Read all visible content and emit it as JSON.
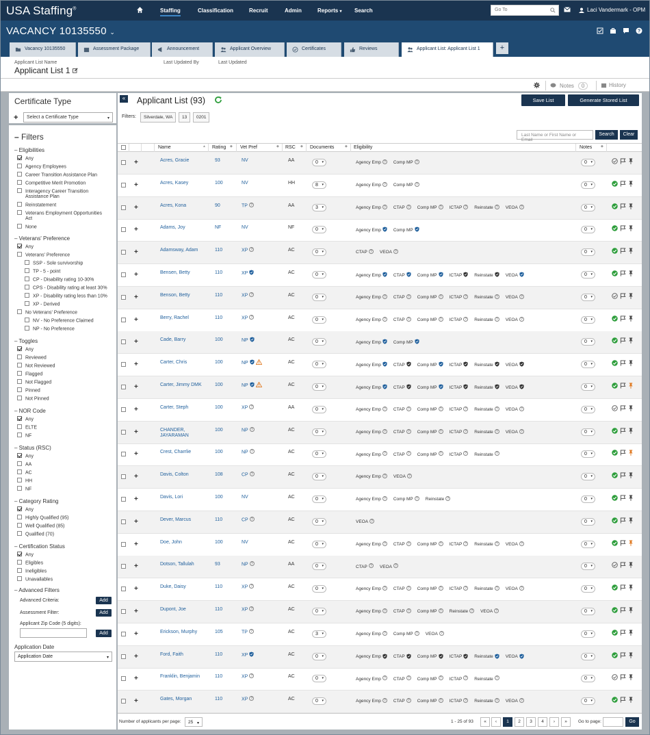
{
  "app": {
    "logo": "USA Staffing",
    "logo_mark": "®"
  },
  "nav": {
    "staffing": "Staffing",
    "classification": "Classification",
    "recruit": "Recruit",
    "admin": "Admin",
    "reports": "Reports",
    "search": "Search",
    "goto_placeholder": "Go To",
    "user": "Laci Vandermark - OPM"
  },
  "vacancy": {
    "title": "VACANCY 10135550"
  },
  "tabs": [
    {
      "label": "Vacancy 10135550",
      "icon": "folder-icon"
    },
    {
      "label": "Assessment Package",
      "icon": "package-icon"
    },
    {
      "label": "Announcement",
      "icon": "megaphone-icon"
    },
    {
      "label": "Applicant Overview",
      "icon": "users-icon"
    },
    {
      "label": "Certificates",
      "icon": "certificate-icon"
    },
    {
      "label": "Reviews",
      "icon": "thumbs-up-icon"
    },
    {
      "label": "Applicant List: Applicant List 1",
      "icon": "users-icon"
    }
  ],
  "tab_add": "+",
  "list_header": {
    "name_label": "Applicant List Name",
    "name": "Applicant List 1",
    "updated_by_label": "Last Updated By",
    "updated_label": "Last Updated",
    "notes_label": "Notes",
    "notes_count": "0",
    "history_label": "History"
  },
  "sidebar": {
    "cert_type_title": "Certificate Type",
    "cert_type_placeholder": "Select a Certificate Type",
    "filters_title": "Filters",
    "eligibilities": {
      "title": "Eligibilities",
      "options": [
        "Any",
        "Agency Employees",
        "Career Transition Assistance Plan",
        "Competitive Merit Promotion",
        "Interagency Career Transition Assistance Plan",
        "Reinstatement",
        "Veterans Employment Opportunities Act",
        "None"
      ]
    },
    "vets": {
      "title": "Veterans' Preference",
      "any": "Any",
      "vp": "Veterans' Preference",
      "vp_sub": [
        "SSP - Sole survivorship",
        "TP - 5 - point",
        "CP - Disability rating 10-30%",
        "CPS - Disability rating at least 30%",
        "XP - Disability rating less than 10%",
        "XP - Derived"
      ],
      "nvp": "No Veterans' Preference",
      "nvp_sub": [
        "NV - No Preference Claimed",
        "NP - No Preference"
      ]
    },
    "toggles": {
      "title": "Toggles",
      "options": [
        "Any",
        "Reviewed",
        "Not Reviewed",
        "Flagged",
        "Not Flagged",
        "Pinned",
        "Not Pinned"
      ]
    },
    "nor": {
      "title": "NOR Code",
      "options": [
        "Any",
        "ELTE",
        "NF"
      ]
    },
    "status": {
      "title": "Status (RSC)",
      "options": [
        "Any",
        "AA",
        "AC",
        "HH",
        "NF"
      ]
    },
    "category": {
      "title": "Category Rating",
      "options": [
        "Any",
        "Highly Qualified (95)",
        "Well Qualified (85)",
        "Qualified (70)"
      ]
    },
    "cert_status": {
      "title": "Certification Status",
      "options": [
        "Any",
        "Eligibles",
        "Ineligibles",
        "Unavailables"
      ]
    },
    "advanced": {
      "title": "Advanced Filters",
      "criteria": "Advanced Criteria:",
      "assessment": "Assessment Filter:",
      "zip": "Applicant Zip Code (5 digits):",
      "add": "Add"
    },
    "app_date_label": "Application Date",
    "app_date_value": "Application Date"
  },
  "main": {
    "title": "Applicant List (93)",
    "save_list": "Save List",
    "generate": "Generate Stored List",
    "filters_label": "Filters:",
    "filter_chips": [
      "Silverdale, WA",
      "13",
      "0201"
    ],
    "search_placeholder": "Last Name or First Name or Email",
    "search": "Search",
    "clear": "Clear"
  },
  "columns": [
    "Name",
    "Rating",
    "Vet Pref",
    "RSC",
    "Documents",
    "Eligibility",
    "Notes"
  ],
  "rows": [
    {
      "name": "Acres, Gracie",
      "rating": "93",
      "vet": "NV",
      "rsc": "AA",
      "docs": "0",
      "notes": "0",
      "elig": [
        [
          "Agency Emp",
          "q"
        ],
        [
          "Comp MP",
          "q"
        ]
      ],
      "reviewed": false,
      "pinned": false
    },
    {
      "name": "Acres, Kasey",
      "rating": "100",
      "vet": "NV",
      "rsc": "HH",
      "docs": "8",
      "notes": "0",
      "elig": [
        [
          "Agency Emp",
          "q"
        ],
        [
          "Comp MP",
          "q"
        ]
      ],
      "reviewed": true,
      "pinned": false
    },
    {
      "name": "Acres, Kona",
      "rating": "90",
      "vet": "TP",
      "veticon": "q",
      "rsc": "AA",
      "docs": "3",
      "notes": "0",
      "elig": [
        [
          "Agency Emp",
          "q"
        ],
        [
          "CTAP",
          "q"
        ],
        [
          "Comp MP",
          "q"
        ],
        [
          "ICTAP",
          "q"
        ],
        [
          "Reinstate",
          "q"
        ],
        [
          "VEOA",
          "q"
        ]
      ],
      "reviewed": true,
      "pinned": false
    },
    {
      "name": "Adams, Joy",
      "rating": "NF",
      "vet": "NV",
      "rsc": "NF",
      "docs": "0",
      "notes": "0",
      "elig": [
        [
          "Agency Emp",
          "blue"
        ],
        [
          "Comp MP",
          "blue"
        ]
      ],
      "reviewed": true,
      "pinned": false
    },
    {
      "name": "Adamsway, Adam",
      "rating": "110",
      "vet": "XP",
      "veticon": "q",
      "rsc": "AC",
      "docs": "0",
      "notes": "0",
      "elig": [
        [
          "CTAP",
          "q"
        ],
        [
          "VEOA",
          "q"
        ]
      ],
      "reviewed": true,
      "pinned": false
    },
    {
      "name": "Bensen, Betty",
      "rating": "110",
      "vet": "XP",
      "veticon": "blue",
      "rsc": "AC",
      "docs": "0",
      "notes": "0",
      "elig": [
        [
          "Agency Emp",
          "blue"
        ],
        [
          "CTAP",
          "blue"
        ],
        [
          "Comp MP",
          "blue"
        ],
        [
          "ICTAP",
          "dark"
        ],
        [
          "Reinstate",
          "dark"
        ],
        [
          "VEOA",
          "blue"
        ]
      ],
      "reviewed": true,
      "pinned": false
    },
    {
      "name": "Benson, Betty",
      "rating": "110",
      "vet": "XP",
      "veticon": "q",
      "rsc": "AC",
      "docs": "0",
      "notes": "0",
      "elig": [
        [
          "Agency Emp",
          "q"
        ],
        [
          "CTAP",
          "q"
        ],
        [
          "Comp MP",
          "q"
        ],
        [
          "ICTAP",
          "q"
        ],
        [
          "Reinstate",
          "q"
        ],
        [
          "VEOA",
          "q"
        ]
      ],
      "reviewed": false,
      "pinned": false
    },
    {
      "name": "Berry, Rachel",
      "rating": "110",
      "vet": "XP",
      "veticon": "q",
      "rsc": "AC",
      "docs": "0",
      "notes": "0",
      "elig": [
        [
          "Agency Emp",
          "q"
        ],
        [
          "CTAP",
          "q"
        ],
        [
          "Comp MP",
          "q"
        ],
        [
          "ICTAP",
          "q"
        ],
        [
          "Reinstate",
          "q"
        ],
        [
          "VEOA",
          "q"
        ]
      ],
      "reviewed": true,
      "pinned": false
    },
    {
      "name": "Cade, Barry",
      "rating": "100",
      "vet": "NP",
      "veticon": "blue",
      "rsc": "AC",
      "docs": "0",
      "notes": "0",
      "elig": [
        [
          "Agency Emp",
          "blue"
        ],
        [
          "Comp MP",
          "blue"
        ]
      ],
      "reviewed": true,
      "pinned": false
    },
    {
      "name": "Carter, Chris",
      "rating": "100",
      "vet": "NP",
      "veticon": "blue",
      "warn": true,
      "rsc": "AC",
      "docs": "0",
      "notes": "0",
      "elig": [
        [
          "Agency Emp",
          "blue"
        ],
        [
          "CTAP",
          "dark"
        ],
        [
          "Comp MP",
          "blue"
        ],
        [
          "ICTAP",
          "dark"
        ],
        [
          "Reinstate",
          "dark"
        ],
        [
          "VEOA",
          "dark"
        ]
      ],
      "reviewed": true,
      "pinned": false
    },
    {
      "name": "Carter, Jimmy DMK",
      "rating": "100",
      "vet": "NP",
      "veticon": "blue",
      "warn": true,
      "rsc": "AC",
      "docs": "0",
      "notes": "0",
      "elig": [
        [
          "Agency Emp",
          "blue"
        ],
        [
          "CTAP",
          "dark"
        ],
        [
          "Comp MP",
          "blue"
        ],
        [
          "ICTAP",
          "dark"
        ],
        [
          "Reinstate",
          "dark"
        ],
        [
          "VEOA",
          "dark"
        ]
      ],
      "reviewed": true,
      "pinned": true
    },
    {
      "name": "Carter, Steph",
      "rating": "100",
      "vet": "XP",
      "veticon": "q",
      "rsc": "AA",
      "docs": "0",
      "notes": "0",
      "elig": [
        [
          "Agency Emp",
          "q"
        ],
        [
          "CTAP",
          "q"
        ],
        [
          "Comp MP",
          "q"
        ],
        [
          "ICTAP",
          "q"
        ],
        [
          "Reinstate",
          "q"
        ],
        [
          "VEOA",
          "q"
        ]
      ],
      "reviewed": false,
      "pinned": false
    },
    {
      "name": "CHANDER, JAYARAMAN",
      "rating": "100",
      "vet": "NP",
      "veticon": "q",
      "rsc": "AC",
      "docs": "0",
      "notes": "0",
      "elig": [
        [
          "Agency Emp",
          "q"
        ],
        [
          "CTAP",
          "q"
        ],
        [
          "Comp MP",
          "q"
        ],
        [
          "ICTAP",
          "q"
        ],
        [
          "Reinstate",
          "q"
        ],
        [
          "VEOA",
          "q"
        ]
      ],
      "reviewed": true,
      "pinned": false
    },
    {
      "name": "Crest, Charrlie",
      "rating": "100",
      "vet": "NP",
      "veticon": "q",
      "rsc": "AC",
      "docs": "0",
      "notes": "0",
      "elig": [
        [
          "Agency Emp",
          "q"
        ],
        [
          "CTAP",
          "q"
        ],
        [
          "Comp MP",
          "q"
        ],
        [
          "ICTAP",
          "q"
        ],
        [
          "Reinstate",
          "q"
        ]
      ],
      "reviewed": true,
      "pinned": true
    },
    {
      "name": "Davis, Colton",
      "rating": "108",
      "vet": "CP",
      "veticon": "q",
      "rsc": "AC",
      "docs": "0",
      "notes": "0",
      "elig": [
        [
          "Agency Emp",
          "q"
        ],
        [
          "VEOA",
          "q"
        ]
      ],
      "reviewed": true,
      "pinned": false
    },
    {
      "name": "Davis, Lori",
      "rating": "100",
      "vet": "NV",
      "rsc": "AC",
      "docs": "0",
      "notes": "0",
      "elig": [
        [
          "Agency Emp",
          "q"
        ],
        [
          "Comp MP",
          "q"
        ],
        [
          "Reinstate",
          "q"
        ]
      ],
      "reviewed": true,
      "pinned": false
    },
    {
      "name": "Dever, Marcus",
      "rating": "110",
      "vet": "CP",
      "veticon": "q",
      "rsc": "AC",
      "docs": "0",
      "notes": "0",
      "elig": [
        [
          "VEOA",
          "q"
        ]
      ],
      "reviewed": true,
      "pinned": false
    },
    {
      "name": "Doe, John",
      "rating": "100",
      "vet": "NV",
      "rsc": "AC",
      "docs": "0",
      "notes": "0",
      "elig": [
        [
          "Agency Emp",
          "q"
        ],
        [
          "CTAP",
          "q"
        ],
        [
          "Comp MP",
          "q"
        ],
        [
          "ICTAP",
          "q"
        ],
        [
          "Reinstate",
          "q"
        ],
        [
          "VEOA",
          "q"
        ]
      ],
      "reviewed": true,
      "pinned": true
    },
    {
      "name": "Dotson, Tallulah",
      "rating": "93",
      "vet": "NP",
      "veticon": "q",
      "rsc": "AA",
      "docs": "0",
      "notes": "0",
      "elig": [
        [
          "CTAP",
          "q"
        ],
        [
          "VEOA",
          "q"
        ]
      ],
      "reviewed": false,
      "pinned": false
    },
    {
      "name": "Duke, Daisy",
      "rating": "110",
      "vet": "XP",
      "veticon": "q",
      "rsc": "AC",
      "docs": "0",
      "notes": "0",
      "elig": [
        [
          "Agency Emp",
          "q"
        ],
        [
          "CTAP",
          "q"
        ],
        [
          "Comp MP",
          "q"
        ],
        [
          "ICTAP",
          "q"
        ],
        [
          "Reinstate",
          "q"
        ],
        [
          "VEOA",
          "q"
        ]
      ],
      "reviewed": true,
      "pinned": false
    },
    {
      "name": "Dupont, Joe",
      "rating": "110",
      "vet": "XP",
      "veticon": "q",
      "rsc": "AC",
      "docs": "0",
      "notes": "0",
      "elig": [
        [
          "Agency Emp",
          "q"
        ],
        [
          "CTAP",
          "q"
        ],
        [
          "Comp MP",
          "q"
        ],
        [
          "Reinstate",
          "q"
        ],
        [
          "VEOA",
          "q"
        ]
      ],
      "reviewed": true,
      "pinned": false
    },
    {
      "name": "Erickson, Murphy",
      "rating": "105",
      "vet": "TP",
      "veticon": "q",
      "rsc": "AC",
      "docs": "3",
      "notes": "0",
      "elig": [
        [
          "Agency Emp",
          "q"
        ],
        [
          "Comp MP",
          "q"
        ],
        [
          "VEOA",
          "q"
        ]
      ],
      "reviewed": true,
      "pinned": false
    },
    {
      "name": "Ford, Faith",
      "rating": "110",
      "vet": "XP",
      "veticon": "blue",
      "rsc": "AC",
      "docs": "0",
      "notes": "0",
      "elig": [
        [
          "Agency Emp",
          "dark"
        ],
        [
          "CTAP",
          "dark"
        ],
        [
          "Comp MP",
          "dark"
        ],
        [
          "ICTAP",
          "dark"
        ],
        [
          "Reinstate",
          "blue"
        ],
        [
          "VEOA",
          "blue"
        ]
      ],
      "reviewed": true,
      "pinned": false
    },
    {
      "name": "Franklin, Benjamin",
      "rating": "110",
      "vet": "XP",
      "veticon": "q",
      "rsc": "AC",
      "docs": "0",
      "notes": "0",
      "elig": [
        [
          "Agency Emp",
          "q"
        ],
        [
          "CTAP",
          "q"
        ],
        [
          "Comp MP",
          "q"
        ],
        [
          "ICTAP",
          "q"
        ],
        [
          "Reinstate",
          "q"
        ]
      ],
      "reviewed": false,
      "pinned": false
    },
    {
      "name": "Gates, Morgan",
      "rating": "110",
      "vet": "XP",
      "veticon": "q",
      "rsc": "AC",
      "docs": "0",
      "notes": "0",
      "elig": [
        [
          "Agency Emp",
          "q"
        ],
        [
          "CTAP",
          "q"
        ],
        [
          "Comp MP",
          "q"
        ],
        [
          "ICTAP",
          "q"
        ],
        [
          "Reinstate",
          "q"
        ],
        [
          "VEOA",
          "q"
        ]
      ],
      "reviewed": true,
      "pinned": false
    }
  ],
  "pagination": {
    "per_page_label": "Number of applicants per page:",
    "per_page": "25",
    "range": "1 - 25 of 93",
    "first": "«",
    "prev": "‹",
    "pages": [
      "1",
      "2",
      "3",
      "4"
    ],
    "next": "›",
    "last": "»",
    "goto_label": "Go to page:",
    "go": "Go"
  },
  "colors": {
    "navy": "#1a3450",
    "vacancy_bar": "#1f4a72",
    "link": "#1f5f9c",
    "green": "#2e9e3c",
    "orange": "#e07b24"
  }
}
